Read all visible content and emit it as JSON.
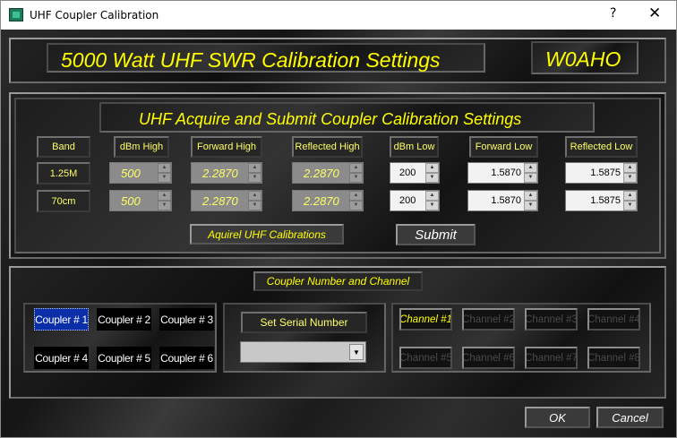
{
  "window": {
    "title": "UHF Coupler Calibration",
    "help_glyph": "?",
    "close_glyph": "✕"
  },
  "header": {
    "title": "5000 Watt  UHF SWR Calibration Settings",
    "callsign": "W0AHO"
  },
  "acquire": {
    "title": "UHF Acquire and Submit Coupler Calibration Settings",
    "columns": [
      "Band",
      "dBm High",
      "Forward High",
      "Reflected High",
      "dBm Low",
      "Forward Low",
      "Reflected Low"
    ],
    "rows": [
      {
        "band": "1.25M",
        "dbm_high": "500",
        "forward_high": "2.2870",
        "reflected_high": "2.2870",
        "dbm_low": "200",
        "forward_low": "1.5870",
        "reflected_low": "1.5875"
      },
      {
        "band": "70cm",
        "dbm_high": "500",
        "forward_high": "2.2870",
        "reflected_high": "2.2870",
        "dbm_low": "200",
        "forward_low": "1.5870",
        "reflected_low": "1.5875"
      }
    ],
    "acquire_label": "Aquirel UHF Calibrations",
    "submit_label": "Submit"
  },
  "coupler": {
    "title": "Coupler Number and Channel",
    "couplers": [
      "Coupler # 1",
      "Coupler # 2",
      "Coupler # 3",
      "Coupler # 4",
      "Coupler # 5",
      "Coupler # 6"
    ],
    "selected_coupler": "Coupler # 1",
    "serial_label": "Set Serial Number",
    "serial_value": "",
    "channels": [
      "Channel #1",
      "Channel #2",
      "Channel #3",
      "Channel #4",
      "Channel #5",
      "Channel #6",
      "Channel #7",
      "Channel #8"
    ],
    "selected_channel": "Channel #1"
  },
  "footer": {
    "ok_label": "OK",
    "cancel_label": "Cancel"
  },
  "colors": {
    "accent_text": "#ffff00",
    "selected_coupler_bg": "#0a2da8"
  }
}
